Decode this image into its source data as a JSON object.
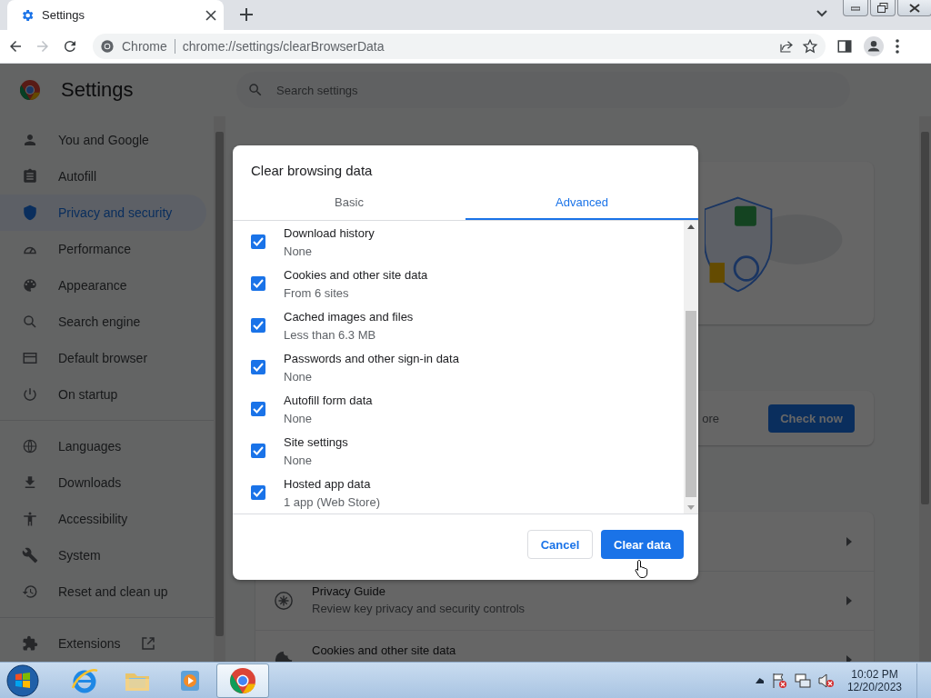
{
  "browser_tabs": [
    {
      "title": "Settings",
      "selected": true
    }
  ],
  "toolbar": {
    "forward_disabled": true,
    "site_label": "Chrome",
    "url": "chrome://settings/clearBrowserData"
  },
  "settings_header": {
    "title": "Settings",
    "search": {
      "placeholder": "Search settings"
    }
  },
  "sidebar": {
    "sections": [
      {
        "items": [
          {
            "label": "You and Google",
            "selected": false
          },
          {
            "label": "Autofill",
            "selected": false
          },
          {
            "label": "Privacy and security",
            "selected": true
          },
          {
            "label": "Performance",
            "selected": false
          },
          {
            "label": "Appearance",
            "selected": false
          },
          {
            "label": "Search engine",
            "selected": false
          },
          {
            "label": "Default browser",
            "selected": false
          },
          {
            "label": "On startup",
            "selected": false
          }
        ]
      },
      {
        "items": [
          {
            "label": "Languages",
            "selected": false
          },
          {
            "label": "Downloads",
            "selected": false
          },
          {
            "label": "Accessibility",
            "selected": false
          },
          {
            "label": "System",
            "selected": false
          },
          {
            "label": "Reset and clean up",
            "selected": false
          }
        ]
      },
      {
        "items": [
          {
            "label": "Extensions",
            "selected": false,
            "external": true
          }
        ]
      }
    ]
  },
  "safety_check": {
    "text_fragment": "ore",
    "button": "Check now"
  },
  "privacy_rows": [
    {
      "kind": "covered"
    },
    {
      "kind": "entry",
      "title": "Privacy Guide",
      "subtitle": "Review key privacy and security controls"
    },
    {
      "kind": "entry",
      "title": "Cookies and other site data"
    }
  ],
  "dialog": {
    "title": "Clear browsing data",
    "tabs": [
      {
        "label": "Basic",
        "selected": false
      },
      {
        "label": "Advanced",
        "selected": true
      }
    ],
    "items": [
      {
        "label": "Download history",
        "detail": "None",
        "checked": true
      },
      {
        "label": "Cookies and other site data",
        "detail": "From 6 sites",
        "checked": true
      },
      {
        "label": "Cached images and files",
        "detail": "Less than 6.3 MB",
        "checked": true
      },
      {
        "label": "Passwords and other sign-in data",
        "detail": "None",
        "checked": true
      },
      {
        "label": "Autofill form data",
        "detail": "None",
        "checked": true
      },
      {
        "label": "Site settings",
        "detail": "None",
        "checked": true
      },
      {
        "label": "Hosted app data",
        "detail": "1 app (Web Store)",
        "checked": true
      }
    ],
    "buttons": [
      {
        "label": "Cancel",
        "kind": "secondary"
      },
      {
        "label": "Clear data",
        "kind": "primary"
      }
    ]
  },
  "taskbar": {
    "apps": [
      {
        "selected": false
      },
      {
        "selected": false
      },
      {
        "selected": false
      },
      {
        "selected": true
      }
    ],
    "clock": {
      "time": "10:02 PM",
      "date": "12/20/2023"
    }
  }
}
